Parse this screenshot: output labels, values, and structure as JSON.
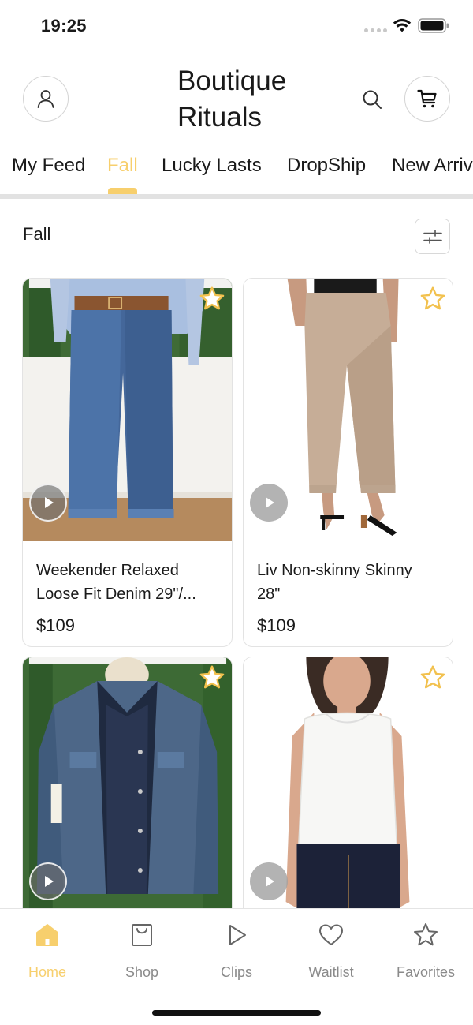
{
  "status_bar": {
    "time": "19:25"
  },
  "header": {
    "title": "Boutique Rituals"
  },
  "tabs": [
    {
      "label": "My Feed",
      "active": false
    },
    {
      "label": "Fall",
      "active": true
    },
    {
      "label": "Lucky Lasts",
      "active": false
    },
    {
      "label": "DropShip",
      "active": false
    },
    {
      "label": "New Arriv",
      "active": false
    }
  ],
  "section": {
    "title": "Fall"
  },
  "products": [
    {
      "name": "Weekender Relaxed Loose Fit Denim 29\"/...",
      "price": "$109"
    },
    {
      "name": "Liv Non-skinny Skinny 28\"",
      "price": "$109"
    },
    {
      "name": "",
      "price": ""
    },
    {
      "name": "",
      "price": ""
    }
  ],
  "bottom_nav": [
    {
      "label": "Home",
      "icon": "home-icon",
      "active": true
    },
    {
      "label": "Shop",
      "icon": "bag-icon",
      "active": false
    },
    {
      "label": "Clips",
      "icon": "play-icon",
      "active": false
    },
    {
      "label": "Waitlist",
      "icon": "heart-icon",
      "active": false
    },
    {
      "label": "Favorites",
      "icon": "star-icon",
      "active": false
    }
  ],
  "colors": {
    "accent": "#f7cf6d",
    "muted": "#8a8a8a",
    "border": "#e3e3e3"
  }
}
